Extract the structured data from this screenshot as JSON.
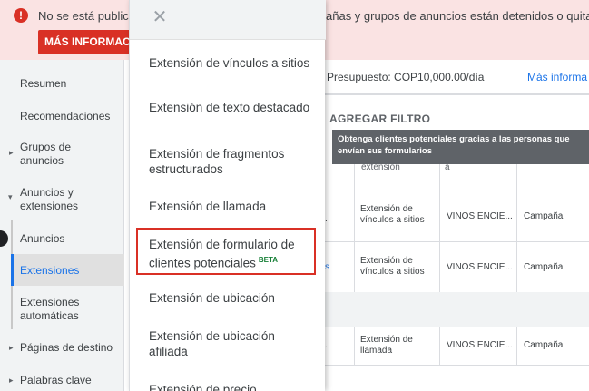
{
  "banner": {
    "message_left": "No se está publicar",
    "message_right": "añas y grupos de anuncios están detenidos o quitados.",
    "button_label": "MÁS INFORMACIÓN",
    "icon": "warning-icon"
  },
  "sidebar": {
    "items": [
      {
        "label": "Resumen"
      },
      {
        "label": "Recomendaciones"
      },
      {
        "label": "Grupos de anuncios"
      },
      {
        "label": "Anuncios y extensiones"
      },
      {
        "label": "Anuncios"
      },
      {
        "label": "Extensiones"
      },
      {
        "label": "Extensiones automáticas"
      },
      {
        "label": "Páginas de destino"
      },
      {
        "label": "Palabras clave"
      }
    ]
  },
  "header": {
    "budget": "Presupuesto: COP10,000.00/día",
    "more_info": "Más informa"
  },
  "toolbar": {
    "filter_label": "AGREGAR FILTRO"
  },
  "tooltip": {
    "text": "Obtenga clientes potenciales gracias a las personas que envían sus formularios"
  },
  "table": {
    "header_fragments": [
      "extensión",
      "a"
    ],
    "rows": [
      {
        "type": "Extensión de vínculos a sitios",
        "campaign": "VINOS ENCIE...",
        "level": "Campaña"
      },
      {
        "type": "Extensión de vínculos a sitios",
        "campaign": "VINOS ENCIE...",
        "level": "Campaña"
      },
      {
        "type": "Extensión de llamada",
        "campaign": "VINOS ENCIE...",
        "level": "Campaña"
      }
    ]
  },
  "dropdown": {
    "items": [
      {
        "label": "Extensión de vínculos a sitios"
      },
      {
        "label": "Extensión de texto destacado"
      },
      {
        "label": "Extensión de fragmentos estructurados"
      },
      {
        "label": "Extensión de llamada"
      },
      {
        "label": "Extensión de formulario de clientes potenciales",
        "badge": "BETA"
      },
      {
        "label": "Extensión de ubicación"
      },
      {
        "label": "Extensión de ubicación afiliada"
      },
      {
        "label": "Extensión de precio"
      }
    ]
  },
  "colors": {
    "accent": "#1a73e8",
    "error": "#d93025",
    "banner_bg": "#fae3e3",
    "beta": "#188038"
  }
}
